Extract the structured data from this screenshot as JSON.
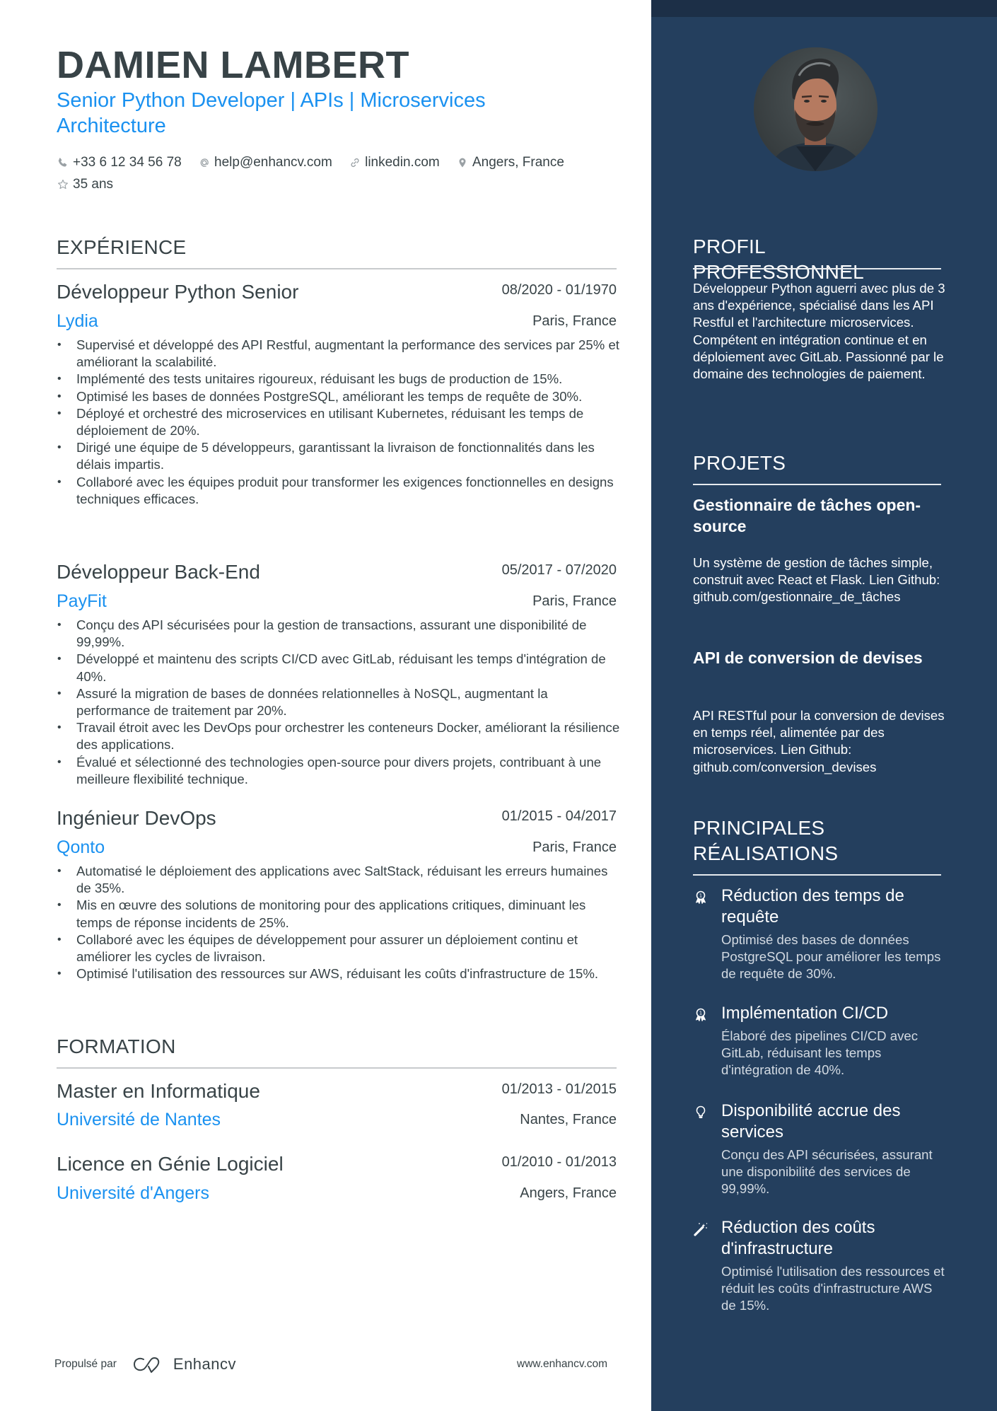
{
  "header": {
    "name": "DAMIEN LAMBERT",
    "headline": "Senior Python Developer | APIs | Microservices Architecture",
    "contacts": [
      {
        "icon": "phone-icon",
        "text": "+33 6 12 34 56 78"
      },
      {
        "icon": "at-icon",
        "text": "help@enhancv.com"
      },
      {
        "icon": "link-icon",
        "text": "linkedin.com"
      },
      {
        "icon": "location-pin-icon",
        "text": "Angers, France"
      },
      {
        "icon": "star-icon",
        "text": "35 ans"
      }
    ]
  },
  "experience": {
    "title": "EXPÉRIENCE",
    "jobs": [
      {
        "title": "Développeur Python Senior",
        "dates": "08/2020 - 01/1970",
        "company": "Lydia",
        "location": "Paris, France",
        "bullets": [
          "Supervisé et développé des API Restful, augmentant la performance des services par 25% et améliorant la scalabilité.",
          "Implémenté des tests unitaires rigoureux, réduisant les bugs de production de 15%.",
          "Optimisé les bases de données PostgreSQL, améliorant les temps de requête de 30%.",
          "Déployé et orchestré des microservices en utilisant Kubernetes, réduisant les temps de déploiement de 20%.",
          "Dirigé une équipe de 5 développeurs, garantissant la livraison de fonctionnalités dans les délais impartis.",
          "Collaboré avec les équipes produit pour transformer les exigences fonctionnelles en designs techniques efficaces."
        ]
      },
      {
        "title": "Développeur Back-End",
        "dates": "05/2017 - 07/2020",
        "company": "PayFit",
        "location": "Paris, France",
        "bullets": [
          "Conçu des API sécurisées pour la gestion de transactions, assurant une disponibilité de 99,99%.",
          "Développé et maintenu des scripts CI/CD avec GitLab, réduisant les temps d'intégration de 40%.",
          "Assuré la migration de bases de données relationnelles à NoSQL, augmentant la performance de traitement par 20%.",
          "Travail étroit avec les DevOps pour orchestrer les conteneurs Docker, améliorant la résilience des applications.",
          "Évalué et sélectionné des technologies open-source pour divers projets, contribuant à une meilleure flexibilité technique."
        ]
      },
      {
        "title": "Ingénieur DevOps",
        "dates": "01/2015 - 04/2017",
        "company": "Qonto",
        "location": "Paris, France",
        "bullets": [
          "Automatisé le déploiement des applications avec SaltStack, réduisant les erreurs humaines de 35%.",
          "Mis en œuvre des solutions de monitoring pour des applications critiques, diminuant les temps de réponse incidents de 25%.",
          "Collaboré avec les équipes de développement pour assurer un déploiement continu et améliorer les cycles de livraison.",
          "Optimisé l'utilisation des ressources sur AWS, réduisant les coûts d'infrastructure de 15%."
        ]
      }
    ]
  },
  "education": {
    "title": "FORMATION",
    "items": [
      {
        "degree": "Master en Informatique",
        "dates": "01/2013 - 01/2015",
        "school": "Université de Nantes",
        "location": "Nantes, France"
      },
      {
        "degree": "Licence en Génie Logiciel",
        "dates": "01/2010 - 01/2013",
        "school": "Université d'Angers",
        "location": "Angers, France"
      }
    ]
  },
  "footer": {
    "powered_by": "Propulsé par",
    "brand": "Enhancv",
    "website": "www.enhancv.com"
  },
  "sidebar": {
    "profile": {
      "title": "PROFIL PROFESSIONNEL",
      "text": "Développeur Python aguerri avec plus de 3 ans d'expérience, spécialisé dans les API Restful et l'architecture microservices. Compétent en intégration continue et en déploiement avec GitLab. Passionné par le domaine des technologies de paiement."
    },
    "projects": {
      "title": "PROJETS",
      "items": [
        {
          "title": "Gestionnaire de tâches open-source",
          "description": "Un système de gestion de tâches simple, construit avec React et Flask. Lien Github: github.com/gestionnaire_de_tâches"
        },
        {
          "title": "API de conversion de devises",
          "description": "API RESTful pour la conversion de devises en temps réel, alimentée par des microservices. Lien Github: github.com/conversion_devises"
        }
      ]
    },
    "achievements": {
      "title": "PRINCIPALES RÉALISATIONS",
      "items": [
        {
          "icon": "award-ribbon-icon",
          "title": "Réduction des temps de requête",
          "description": "Optimisé des bases de données PostgreSQL pour améliorer les temps de requête de 30%."
        },
        {
          "icon": "award-ribbon-icon",
          "title": "Implémentation CI/CD",
          "description": "Élaboré des pipelines CI/CD avec GitLab, réduisant les temps d'intégration de 40%."
        },
        {
          "icon": "lightbulb-icon",
          "title": "Disponibilité accrue des services",
          "description": "Conçu des API sécurisées, assurant une disponibilité des services de 99,99%."
        },
        {
          "icon": "magic-wand-icon",
          "title": "Réduction des coûts d'infrastructure",
          "description": "Optimisé l'utilisation des ressources et réduit les coûts d'infrastructure AWS de 15%."
        }
      ]
    }
  },
  "colors": {
    "accent": "#1a91f0",
    "text": "#384347",
    "sidebar_bg": "#243f5e",
    "sidebar_band": "#1c2f47"
  }
}
